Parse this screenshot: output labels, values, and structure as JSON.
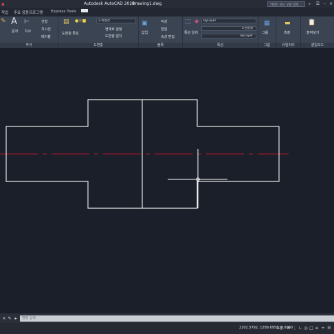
{
  "titlebar": {
    "app_title": "Autodesk AutoCAD 2024",
    "file_name": "Drawing1.dwg",
    "search_placeholder": "키워드 또는 구문 입력"
  },
  "menu_tabs": [
    "작업",
    "주요 응용프로그램",
    "Express Tools"
  ],
  "ribbon": {
    "text_tool": "문자",
    "dimension_tool": "치수",
    "leader_tool": "지시선",
    "table_tool": "테이블",
    "leader_dropdown": "선형",
    "annotation_label": "주석",
    "layer_properties": "도면층 특성",
    "layer_name": "2-외형선",
    "layer_match": "현재로 설정",
    "layer_match2": "도면층 일치",
    "layer_label": "도면층",
    "insert_tool": "삽입",
    "create_block": "작성",
    "edit_block": "편집",
    "edit_attributes": "속성 편집",
    "block_label": "블록",
    "match_properties": "특성 일치",
    "color_value": "ByLayer",
    "linetype_value": "도면층별",
    "lineweight_value": "ByLayer",
    "properties_label": "특성",
    "group_tool": "그룹",
    "groups_label": "그룹",
    "measure_tool": "측정",
    "utilities_label": "유틸리티",
    "paste_tool": "붙여넣기",
    "clipboard_label": "클립보드"
  },
  "command": {
    "placeholder": "명령 입력"
  },
  "status": {
    "coordinates": "2202.5792, 1289.6957, 0.0000",
    "model": "모형"
  },
  "colors": {
    "background": "#1b1f29",
    "geometry": "#e6e6e6",
    "center_line": "#b0142c",
    "ribbon": "#3b4453"
  }
}
